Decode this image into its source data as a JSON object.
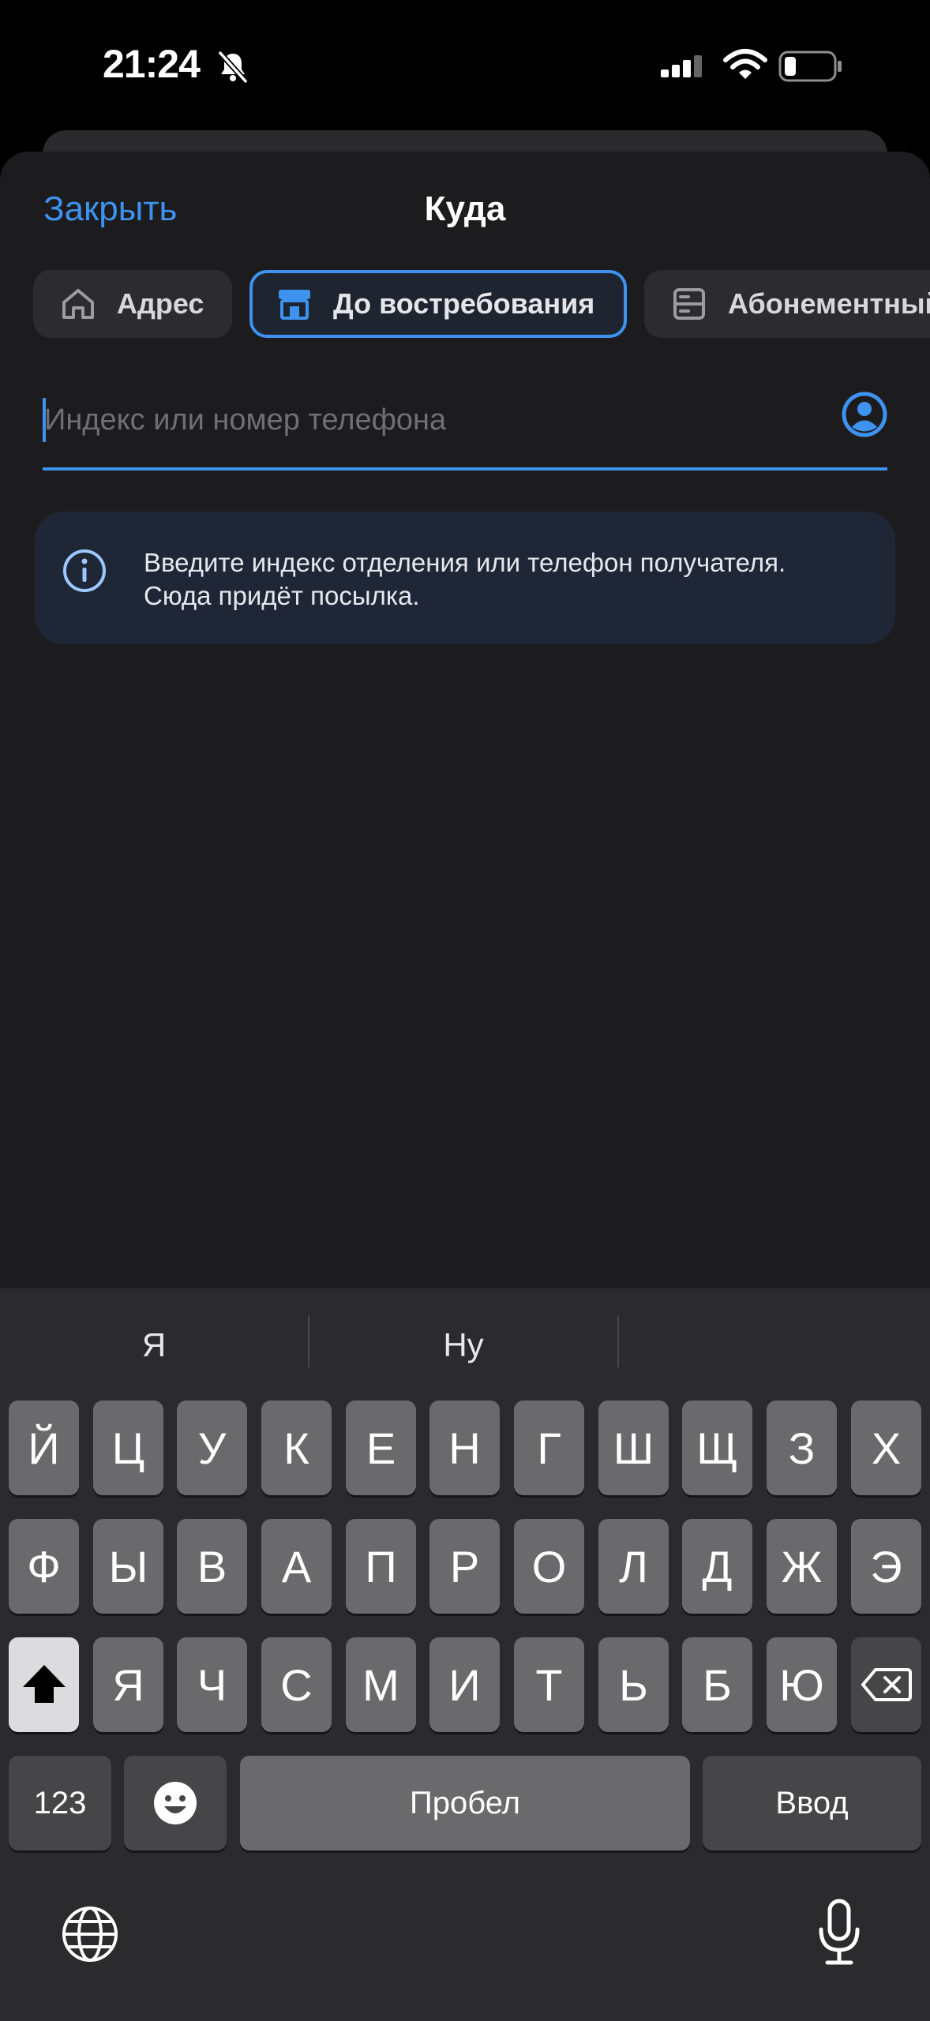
{
  "status_bar": {
    "time": "21:24"
  },
  "header": {
    "close_label": "Закрыть",
    "title": "Куда"
  },
  "tabs": [
    {
      "label": "Адрес",
      "icon": "house-icon",
      "selected": false
    },
    {
      "label": "До востребования",
      "icon": "storefront-icon",
      "selected": true
    },
    {
      "label": "Абонементный ящик",
      "icon": "cabinet-icon",
      "selected": false
    }
  ],
  "search": {
    "placeholder": "Индекс или номер телефона",
    "value": ""
  },
  "info": {
    "text": "Введите индекс отделения или телефон получателя. Сюда придёт посылка."
  },
  "keyboard": {
    "suggestions": [
      "Я",
      "Ну",
      ""
    ],
    "row1": [
      "Й",
      "Ц",
      "У",
      "К",
      "Е",
      "Н",
      "Г",
      "Ш",
      "Щ",
      "З",
      "Х"
    ],
    "row2": [
      "Ф",
      "Ы",
      "В",
      "А",
      "П",
      "Р",
      "О",
      "Л",
      "Д",
      "Ж",
      "Э"
    ],
    "row3": [
      "Я",
      "Ч",
      "С",
      "М",
      "И",
      "Т",
      "Ь",
      "Б",
      "Ю"
    ],
    "numbers_key": "123",
    "space_key": "Пробел",
    "return_key": "Ввод"
  },
  "colors": {
    "accent": "#3e92f0",
    "sheet_bg": "#1c1c1e",
    "info_bg": "#1f2736",
    "keyboard_bg": "#2b2b2d"
  }
}
